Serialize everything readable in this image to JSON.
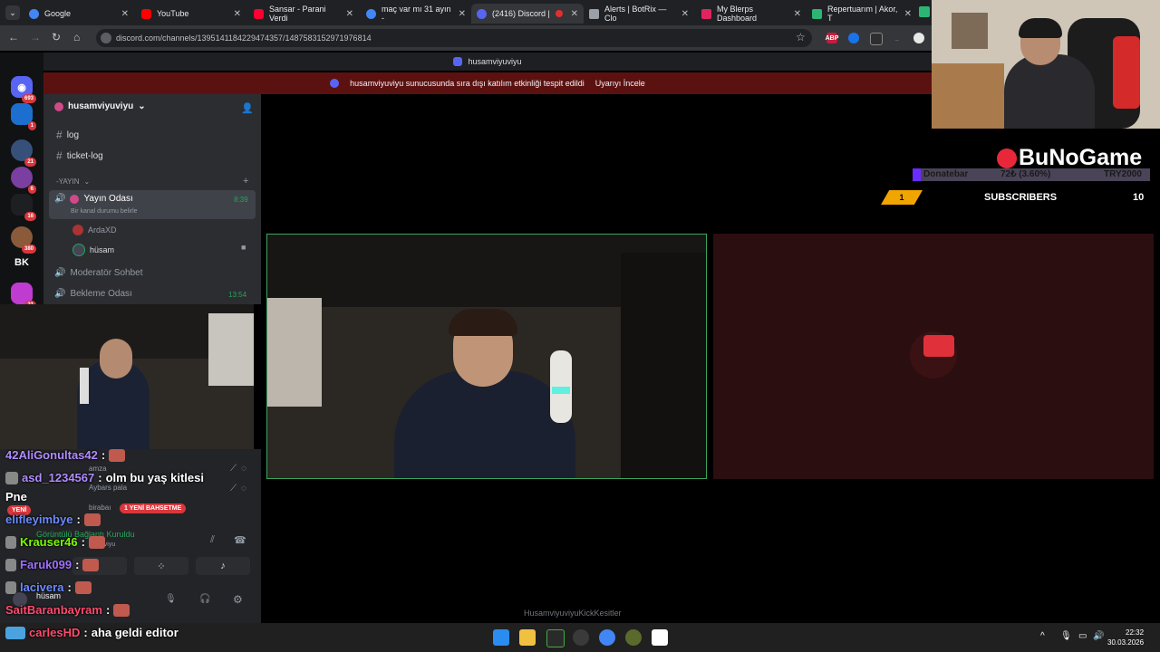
{
  "browser": {
    "tabs": [
      {
        "title": "Google",
        "color": "#4285f4"
      },
      {
        "title": "YouTube",
        "color": "#ff0000"
      },
      {
        "title": "Sansar - Parani Verdi",
        "color": "#ff0033"
      },
      {
        "title": "maç var mı 31 ayın -",
        "color": "#4285f4"
      },
      {
        "title": "(2416) Discord |",
        "color": "#5865f2"
      },
      {
        "title": "Alerts | BotRix — Clo",
        "color": "#9aa0a6"
      },
      {
        "title": "My Blerps Dashboard",
        "color": "#e0245e"
      },
      {
        "title": "Repertuarım | Akor, T",
        "color": "#2bb673"
      }
    ],
    "url": "discord.com/channels/1395141184229474357/1487583152971976814"
  },
  "discord": {
    "window_title": "husamviyuviyu",
    "notice_text": "husamviyuviyu sunucusunda sıra dışı katılım etkinliği tespit edildi",
    "notice_action": "Uyarıyı İncele",
    "server_name": "husamviyuviyu",
    "guild_badges": [
      "693",
      "1",
      "21",
      "6",
      "16",
      "380",
      "BK",
      "21"
    ],
    "channels": {
      "log": "log",
      "ticket_log": "ticket-log",
      "category": "-YAYIN",
      "voice_room": "Yayın Odası",
      "voice_status": "Bir kanal durumu belirle",
      "voice_time": "8:39",
      "members": [
        "ArdaXD",
        "hüsam"
      ],
      "moderator_chat": "Moderatör Sohbet",
      "waiting_room": "Bekleme Odası",
      "waiting_time": "13:54"
    },
    "hidden_members": [
      "amza",
      "Aybars pala",
      "birabaı"
    ],
    "mention_badge": "1 YENİ BAHSETME",
    "new_badge": "YENİ",
    "connection_status": "Görüntülü Bağlantı Kuruldu",
    "connection_sub": "miyuviyu",
    "user_name": "hüsam",
    "stage_label": "HusamviyuviyuKickKesitler"
  },
  "overlay": {
    "brand": "BuNoGame",
    "donation_label": "Donatebar",
    "donation_value": "72₺ (3.60%)",
    "donation_goal": "TRY2000",
    "donation_progress_percent": 3.6,
    "rank": "1",
    "subs_label": "SUBSCRIBERS",
    "subs_count": "10"
  },
  "chat": [
    {
      "user": "42AliGonultas42",
      "msg": "",
      "color": "#b18cff"
    },
    {
      "user": "asd_1234567",
      "msg": "olm bu yaş kitlesi",
      "color": "#b18cff"
    },
    {
      "user": "Pne",
      "msg": "",
      "color": "#ffffff"
    },
    {
      "user": "elifleyimbye",
      "msg": "",
      "color": "#6c8cff"
    },
    {
      "user": "Krauser46",
      "msg": "",
      "color": "#7cfc00"
    },
    {
      "user": "Faruk099",
      "msg": "",
      "color": "#a070ff"
    },
    {
      "user": "lacivera",
      "msg": "",
      "color": "#6c8cff"
    },
    {
      "user": "SaitBaranbayram",
      "msg": "",
      "color": "#ff4b6e"
    },
    {
      "user": "carlesHD",
      "msg": "aha geldi editor",
      "color": "#ff4b6e"
    }
  ],
  "taskbar": {
    "time": "22:32",
    "date": "30.03.2026"
  }
}
